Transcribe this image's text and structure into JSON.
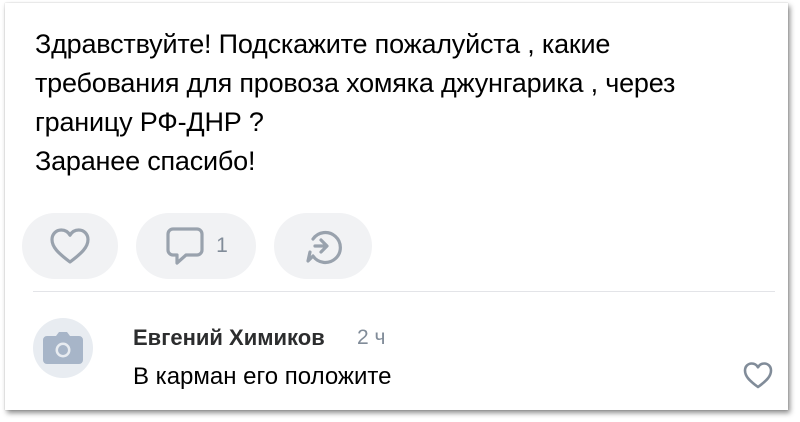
{
  "post": {
    "lines": [
      "Здравствуйте! Подскажите пожалуйста , какие",
      "требования для провоза хомяка джунгарика ,  через",
      "границу РФ-ДНР ?",
      "Заранее спасибо!"
    ]
  },
  "actions": {
    "like_icon": "heart-outline-icon",
    "comment_icon": "comment-icon",
    "comment_count": "1",
    "share_icon": "share-icon"
  },
  "comment": {
    "avatar_icon": "camera-icon",
    "author": "Евгений Химиков",
    "time": "2 ч",
    "text": "В карман его положите",
    "like_icon": "heart-outline-icon"
  },
  "colors": {
    "button_bg": "#f1f2f4",
    "icon_accent": "#99a2ad",
    "secondary_text": "#818c99",
    "avatar_bg": "#e8ecf1"
  }
}
